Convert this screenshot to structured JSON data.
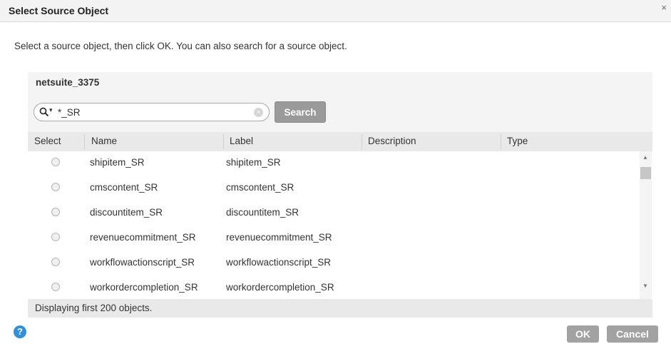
{
  "dialog": {
    "title": "Select Source Object",
    "close_glyph": "×",
    "instructions": "Select a source object, then click OK. You can also search for a source object."
  },
  "panel": {
    "connection": "netsuite_3375"
  },
  "search": {
    "dropdown_glyph": "▾",
    "value": "*_SR",
    "clear_glyph": "×",
    "button_label": "Search"
  },
  "table": {
    "columns": [
      "Select",
      "Name",
      "Label",
      "Description",
      "Type"
    ],
    "rows": [
      {
        "name": "shipitem_SR",
        "label": "shipitem_SR",
        "description": "",
        "type": ""
      },
      {
        "name": "cmscontent_SR",
        "label": "cmscontent_SR",
        "description": "",
        "type": ""
      },
      {
        "name": "discountitem_SR",
        "label": "discountitem_SR",
        "description": "",
        "type": ""
      },
      {
        "name": "revenuecommitment_SR",
        "label": "revenuecommitment_SR",
        "description": "",
        "type": ""
      },
      {
        "name": "workflowactionscript_SR",
        "label": "workflowactionscript_SR",
        "description": "",
        "type": ""
      },
      {
        "name": "workordercompletion_SR",
        "label": "workordercompletion_SR",
        "description": "",
        "type": ""
      }
    ],
    "scroll_up_glyph": "▲",
    "scroll_down_glyph": "▼"
  },
  "status": {
    "text": "Displaying first 200 objects."
  },
  "footer": {
    "help_glyph": "?",
    "ok_label": "OK",
    "cancel_label": "Cancel"
  },
  "colors": {
    "help_blue": "#2f8fd8",
    "button_gray": "#a2a2a2",
    "panel_bg": "#f4f4f4"
  }
}
